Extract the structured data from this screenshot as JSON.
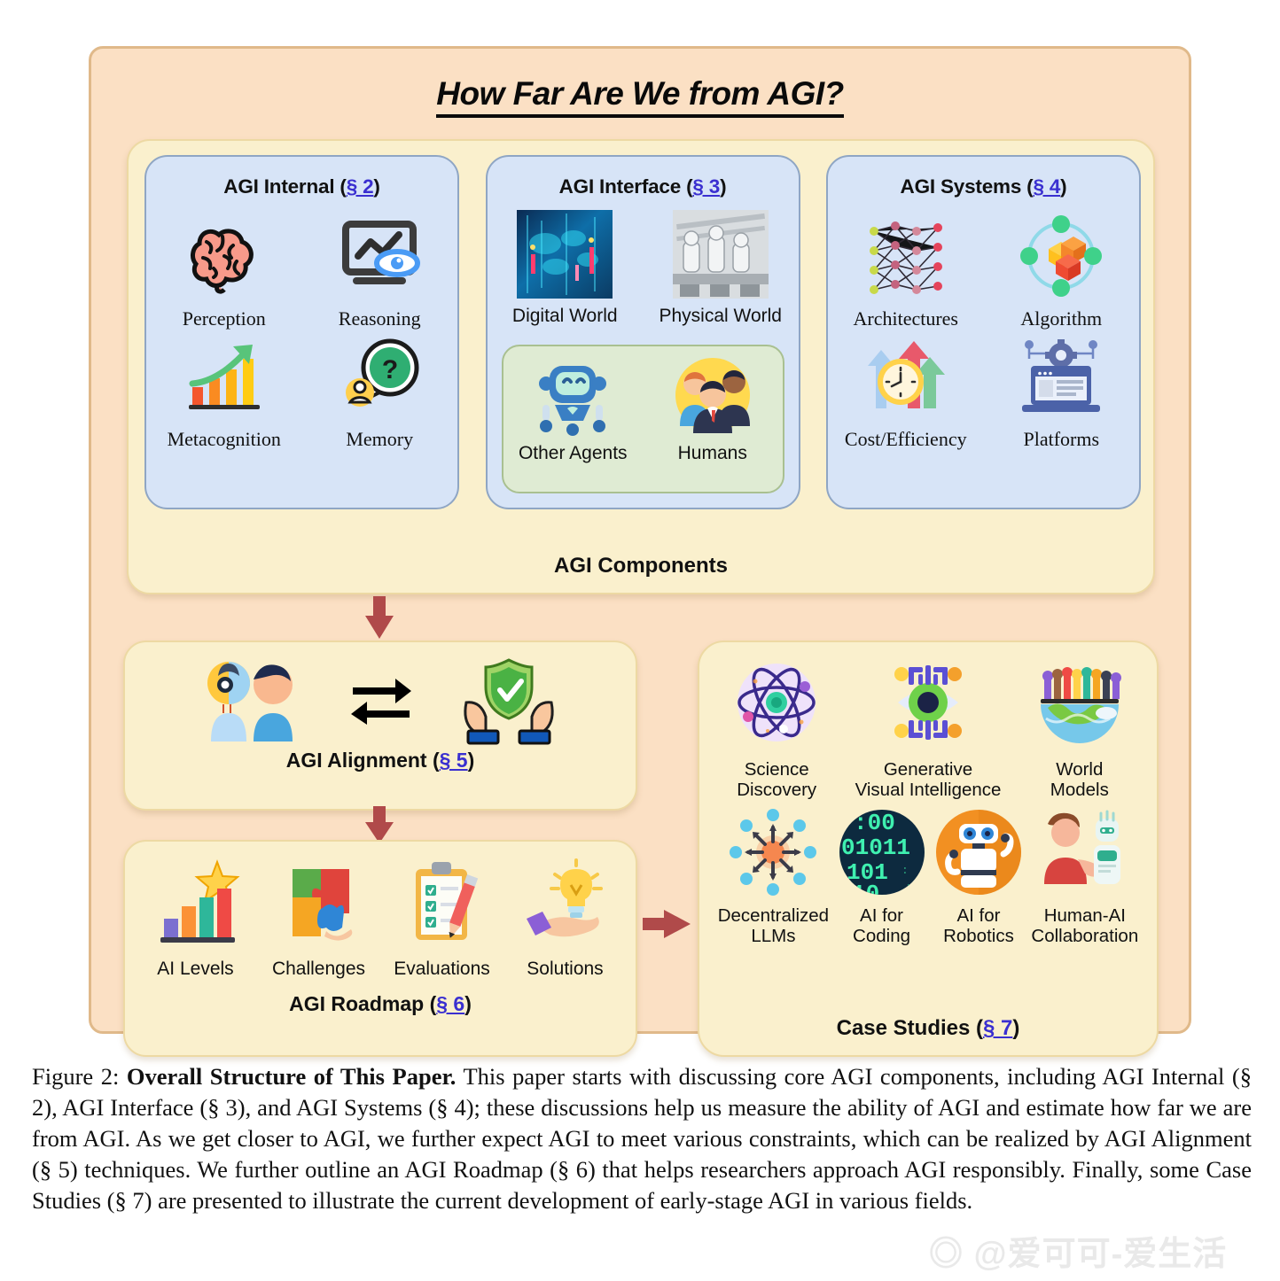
{
  "figure": {
    "title": "How Far Are We from AGI?",
    "components_label": "AGI Components",
    "watermark": "◎ @爱可可-爱生活"
  },
  "colors": {
    "frame_bg": "#FBE0C4",
    "frame_border": "#E0B98A",
    "card_bg": "#FAF0CD",
    "card_border": "#EDD9A3",
    "panel_blue": "#D7E4F7",
    "panel_blue_border": "#8FA6C4",
    "panel_green": "#DFEBD3",
    "panel_green_border": "#A9C091",
    "section_link": "#3A2FD0",
    "arrow": "#B04A4A"
  },
  "panels": [
    {
      "title_text": "AGI Internal (",
      "title_link": "§ 2",
      "title_close": ")",
      "items": [
        {
          "label": "Perception",
          "icon": "brain-icon"
        },
        {
          "label": "Reasoning",
          "icon": "monitor-eye-chart-icon"
        },
        {
          "label": "Metacognition",
          "icon": "growth-bar-chart-icon"
        },
        {
          "label": "Memory",
          "icon": "question-thought-bubble-icon"
        }
      ]
    },
    {
      "title_text": "AGI Interface (",
      "title_link": "§ 3",
      "title_close": ")",
      "items": [
        {
          "label": "Digital World",
          "icon": "digital-globe-image"
        },
        {
          "label": "Physical World",
          "icon": "robot-factory-image"
        }
      ],
      "nested": {
        "items": [
          {
            "label": "Other Agents",
            "icon": "robot-face-icon"
          },
          {
            "label": "Humans",
            "icon": "people-group-icon"
          }
        ]
      }
    },
    {
      "title_text": "AGI Systems (",
      "title_link": "§ 4",
      "title_close": ")",
      "items": [
        {
          "label": "Architectures",
          "icon": "neural-network-icon"
        },
        {
          "label": "Algorithm",
          "icon": "cube-orbit-icon"
        },
        {
          "label": "Cost/Efficiency",
          "icon": "clock-arrows-icon"
        },
        {
          "label": "Platforms",
          "icon": "laptop-gear-icon"
        }
      ]
    }
  ],
  "alignment": {
    "label_text": "AGI Alignment (",
    "label_link": "§ 5",
    "label_close": ")",
    "icons": [
      {
        "name": "robot-human-pair-icon"
      },
      {
        "name": "double-arrow-icon"
      },
      {
        "name": "shield-hands-icon"
      }
    ]
  },
  "roadmap": {
    "label_text": "AGI Roadmap (",
    "label_link": "§ 6",
    "label_close": ")",
    "items": [
      {
        "label": "AI Levels",
        "icon": "bar-chart-star-icon"
      },
      {
        "label": "Challenges",
        "icon": "puzzle-pieces-icon"
      },
      {
        "label": "Evaluations",
        "icon": "clipboard-checklist-icon"
      },
      {
        "label": "Solutions",
        "icon": "hand-lightbulb-icon"
      }
    ]
  },
  "case_studies": {
    "label_text": "Case Studies (",
    "label_link": "§ 7",
    "label_close": ")",
    "row1": [
      {
        "label_line1": "Science",
        "label_line2": "Discovery",
        "icon": "atom-icon"
      },
      {
        "label_line1": "Generative",
        "label_line2": "Visual Intelligence",
        "icon": "digital-eye-icon"
      },
      {
        "label_line1": "World",
        "label_line2": "Models",
        "icon": "globe-people-icon"
      }
    ],
    "row2": [
      {
        "label_line1": "Decentralized",
        "label_line2": "LLMs",
        "icon": "decentralized-network-icon"
      },
      {
        "label_line1": "AI for",
        "label_line2": "Coding",
        "icon": "binary-code-icon"
      },
      {
        "label_line1": "AI for",
        "label_line2": "Robotics",
        "icon": "robot-circle-icon"
      },
      {
        "label_line1": "Human-AI",
        "label_line2": "Collaboration",
        "icon": "human-robot-handshake-icon"
      }
    ]
  },
  "caption": {
    "figure_number": "Figure 2:",
    "bold_title": "Overall Structure of This Paper.",
    "body": "This paper starts with discussing core AGI components, including AGI Internal (§ 2), AGI Interface (§ 3), and AGI Systems (§ 4); these discussions help us measure the ability of AGI and estimate how far we are from AGI. As we get closer to AGI, we further expect AGI to meet various constraints, which can be realized by AGI Alignment (§ 5) techniques. We further outline an AGI Roadmap (§ 6) that helps researchers approach AGI responsibly. Finally, some Case Studies (§ 7) are presented to illustrate the current development of early-stage AGI in various fields."
  }
}
